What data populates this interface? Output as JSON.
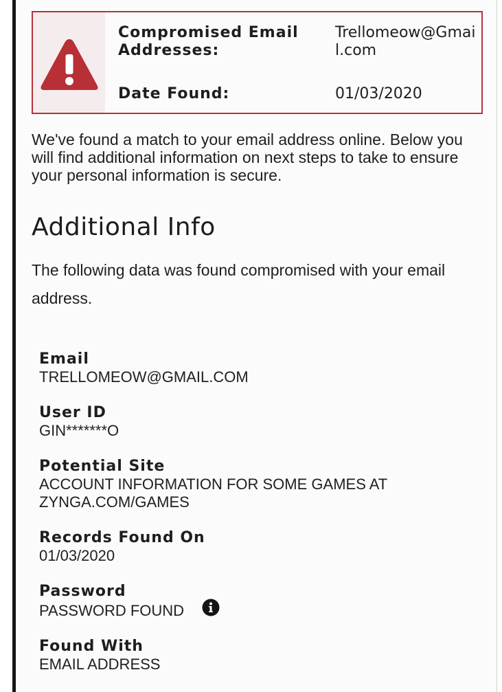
{
  "alert": {
    "emails_label": "Compromised Email Addresses:",
    "emails_value": "Trellomeow@Gmail.com",
    "date_label": "Date Found:",
    "date_value": "01/03/2020",
    "icon": "warning-triangle-icon",
    "border_color": "#b1343a",
    "icon_color": "#b82f36",
    "icon_bg": "#f5ecee"
  },
  "intro_text": "We've found a match to your email address online. Below you will find additional information on next steps to take to ensure your personal information is secure.",
  "additional_info": {
    "title": "Additional Info",
    "description": "The following data was found compromised with your email address.",
    "fields": [
      {
        "label": "Email",
        "value": "TRELLOMEOW@GMAIL.COM"
      },
      {
        "label": "User ID",
        "value": "GIN*******O"
      },
      {
        "label": "Potential Site",
        "value": "ACCOUNT INFORMATION FOR SOME GAMES AT ZYNGA.COM/GAMES"
      },
      {
        "label": "Records Found On",
        "value": "01/03/2020"
      },
      {
        "label": "Password",
        "value": "PASSWORD FOUND",
        "icon": "info-icon"
      },
      {
        "label": "Found With",
        "value": "EMAIL ADDRESS"
      }
    ]
  }
}
